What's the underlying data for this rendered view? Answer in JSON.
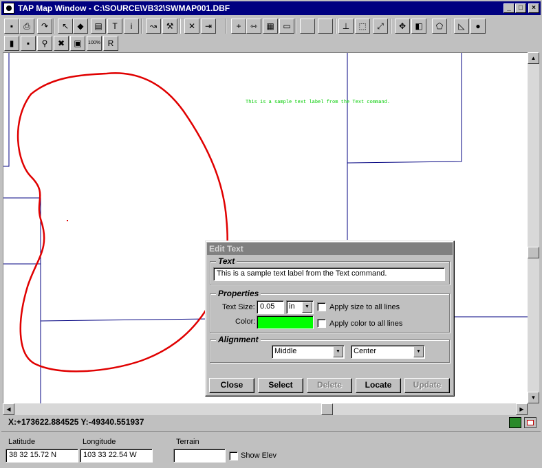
{
  "window": {
    "title": "TAP Map Window - C:\\SOURCE\\VB32\\SWMAP001.DBF",
    "controls": [
      "_",
      "□",
      "×"
    ]
  },
  "toolbar1": [
    {
      "name": "save-icon",
      "glyph": "▪"
    },
    {
      "name": "print-icon",
      "glyph": "⎙"
    },
    {
      "name": "redo-arrow-icon",
      "glyph": "↷"
    },
    {
      "name": "pointer-icon",
      "glyph": "↖"
    },
    {
      "name": "shapes-icon",
      "glyph": "◆"
    },
    {
      "name": "layers-icon",
      "glyph": "▤"
    },
    {
      "name": "text-tool-icon",
      "glyph": "T"
    },
    {
      "name": "info-icon",
      "glyph": "i"
    },
    {
      "name": "route-icon",
      "glyph": "↝"
    },
    {
      "name": "wrench-icon",
      "glyph": "⚒"
    },
    {
      "name": "cross-icon",
      "glyph": "✕"
    },
    {
      "name": "exit-icon",
      "glyph": "⇥"
    },
    {
      "name": "add-icon",
      "glyph": "+"
    },
    {
      "name": "measure-icon",
      "glyph": "⇿"
    },
    {
      "name": "grid-icon",
      "glyph": "▦"
    },
    {
      "name": "document-icon",
      "glyph": "▭"
    },
    {
      "name": "blank1-icon",
      "glyph": ""
    },
    {
      "name": "blank2-icon",
      "glyph": ""
    },
    {
      "name": "axis-icon",
      "glyph": "⊥"
    },
    {
      "name": "zoom-box-icon",
      "glyph": "⬚"
    },
    {
      "name": "expand-icon",
      "glyph": "⤢"
    },
    {
      "name": "pan-icon",
      "glyph": "✥"
    },
    {
      "name": "overlay-icon",
      "glyph": "◧"
    },
    {
      "name": "polygon-icon",
      "glyph": "⬠"
    },
    {
      "name": "profile-icon",
      "glyph": "◺"
    },
    {
      "name": "color-wheel-icon",
      "glyph": "●"
    }
  ],
  "toolbar2": [
    {
      "name": "map-green-icon",
      "glyph": "▮"
    },
    {
      "name": "small-map-icon",
      "glyph": "▪"
    },
    {
      "name": "magnifier-icon",
      "glyph": "⚲"
    },
    {
      "name": "delete-icon",
      "glyph": "✖"
    },
    {
      "name": "terrain-icon",
      "glyph": "▣"
    },
    {
      "name": "zoom-100-icon",
      "glyph": "100%"
    },
    {
      "name": "r-icon",
      "glyph": "R"
    }
  ],
  "map": {
    "label_text": "This is a sample text label from the Text command.",
    "label_color": "#00cc00",
    "outline_color": "#e00000",
    "line_color": "#000080"
  },
  "coords": "X:+173622.884525 Y:-49340.551937",
  "status": {
    "latitude_label": "Latitude",
    "latitude_value": "38 32 15.72 N",
    "longitude_label": "Longitude",
    "longitude_value": "103 33 22.54 W",
    "terrain_label": "Terrain",
    "terrain_value": "",
    "show_elev_label": "Show Elev"
  },
  "dialog": {
    "title": "Edit Text",
    "text_group": "Text",
    "text_value": "This is a sample text label from the Text command.",
    "properties_group": "Properties",
    "text_size_label": "Text Size:",
    "text_size_value": "0.05",
    "unit_value": "in",
    "apply_size_label": "Apply size to all lines",
    "color_label": "Color:",
    "color_value": "#00ff00",
    "apply_color_label": "Apply color to all lines",
    "alignment_group": "Alignment",
    "valign_value": "Middle",
    "halign_value": "Center",
    "buttons": {
      "close": "Close",
      "select": "Select",
      "delete": "Delete",
      "locate": "Locate",
      "update": "Update"
    }
  }
}
